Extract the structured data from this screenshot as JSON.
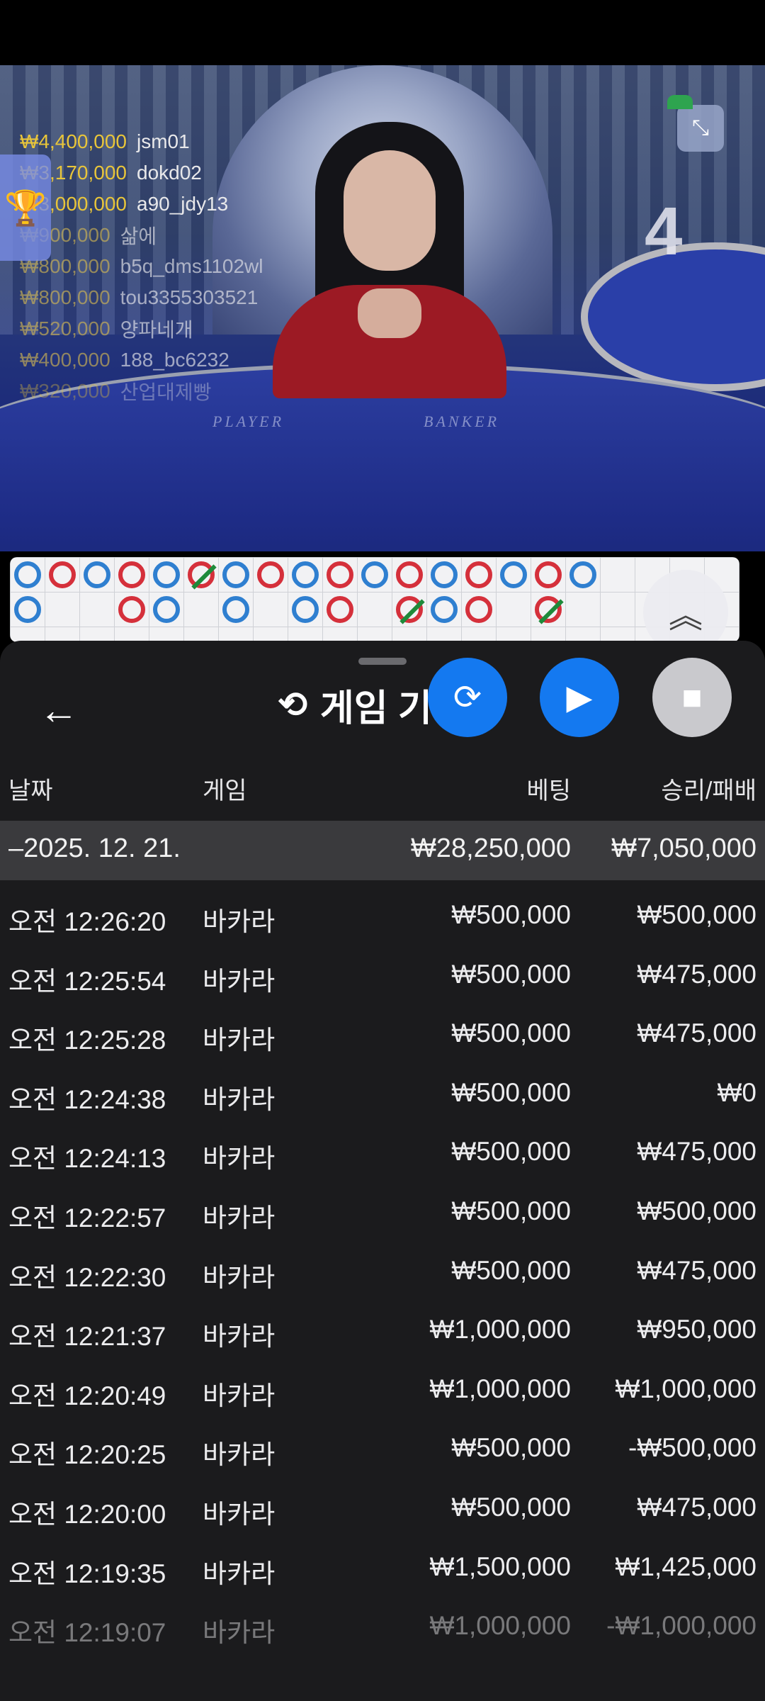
{
  "video": {
    "round_number": "4",
    "table_labels": [
      "PLAYER",
      "BANKER"
    ],
    "leaderboard": [
      {
        "amount": "₩4,400,000",
        "user": "jsm01"
      },
      {
        "amount": "₩3,170,000",
        "user": "dokd02"
      },
      {
        "amount": "₩3,000,000",
        "user": "a90_jdy13"
      },
      {
        "amount": "₩900,000",
        "user": "삶에"
      },
      {
        "amount": "₩800,000",
        "user": "b5q_dms1102wl"
      },
      {
        "amount": "₩800,000",
        "user": "tou3355303521"
      },
      {
        "amount": "₩520,000",
        "user": "양파네개"
      },
      {
        "amount": "₩400,000",
        "user": "188_bc6232"
      },
      {
        "amount": "₩320,000",
        "user": "산업대제빵"
      }
    ],
    "icons": {
      "collapse": "collapse-icon",
      "trophy": "trophy-icon"
    }
  },
  "roadmap": {
    "colors": {
      "player": "#2f7fd0",
      "banker": "#d5303b",
      "tie_slash": "#1e8a3a"
    }
  },
  "sheet": {
    "title": "게임 기록",
    "columns": {
      "date": "날짜",
      "game": "게임",
      "bet": "베팅",
      "winloss": "승리/패배"
    },
    "date_group": {
      "date": "–2025. 12. 21.",
      "bet_total": "₩28,250,000",
      "winloss_total": "₩7,050,000"
    },
    "rows": [
      {
        "time": "오전 12:26:20",
        "game": "바카라",
        "bet": "₩500,000",
        "winloss": "₩500,000"
      },
      {
        "time": "오전 12:25:54",
        "game": "바카라",
        "bet": "₩500,000",
        "winloss": "₩475,000"
      },
      {
        "time": "오전 12:25:28",
        "game": "바카라",
        "bet": "₩500,000",
        "winloss": "₩475,000"
      },
      {
        "time": "오전 12:24:38",
        "game": "바카라",
        "bet": "₩500,000",
        "winloss": "₩0"
      },
      {
        "time": "오전 12:24:13",
        "game": "바카라",
        "bet": "₩500,000",
        "winloss": "₩475,000"
      },
      {
        "time": "오전 12:22:57",
        "game": "바카라",
        "bet": "₩500,000",
        "winloss": "₩500,000"
      },
      {
        "time": "오전 12:22:30",
        "game": "바카라",
        "bet": "₩500,000",
        "winloss": "₩475,000"
      },
      {
        "time": "오전 12:21:37",
        "game": "바카라",
        "bet": "₩1,000,000",
        "winloss": "₩950,000"
      },
      {
        "time": "오전 12:20:49",
        "game": "바카라",
        "bet": "₩1,000,000",
        "winloss": "₩1,000,000"
      },
      {
        "time": "오전 12:20:25",
        "game": "바카라",
        "bet": "₩500,000",
        "winloss": "-₩500,000"
      },
      {
        "time": "오전 12:20:00",
        "game": "바카라",
        "bet": "₩500,000",
        "winloss": "₩475,000"
      },
      {
        "time": "오전 12:19:35",
        "game": "바카라",
        "bet": "₩1,500,000",
        "winloss": "₩1,425,000"
      },
      {
        "time": "오전 12:19:07",
        "game": "바카라",
        "bet": "₩1,000,000",
        "winloss": "-₩1,000,000"
      }
    ],
    "icons": {
      "back": "back-arrow-icon",
      "history": "history-icon",
      "fab1": "rotate-icon",
      "fab2": "replay-icon",
      "fab3": "stop-icon"
    }
  }
}
